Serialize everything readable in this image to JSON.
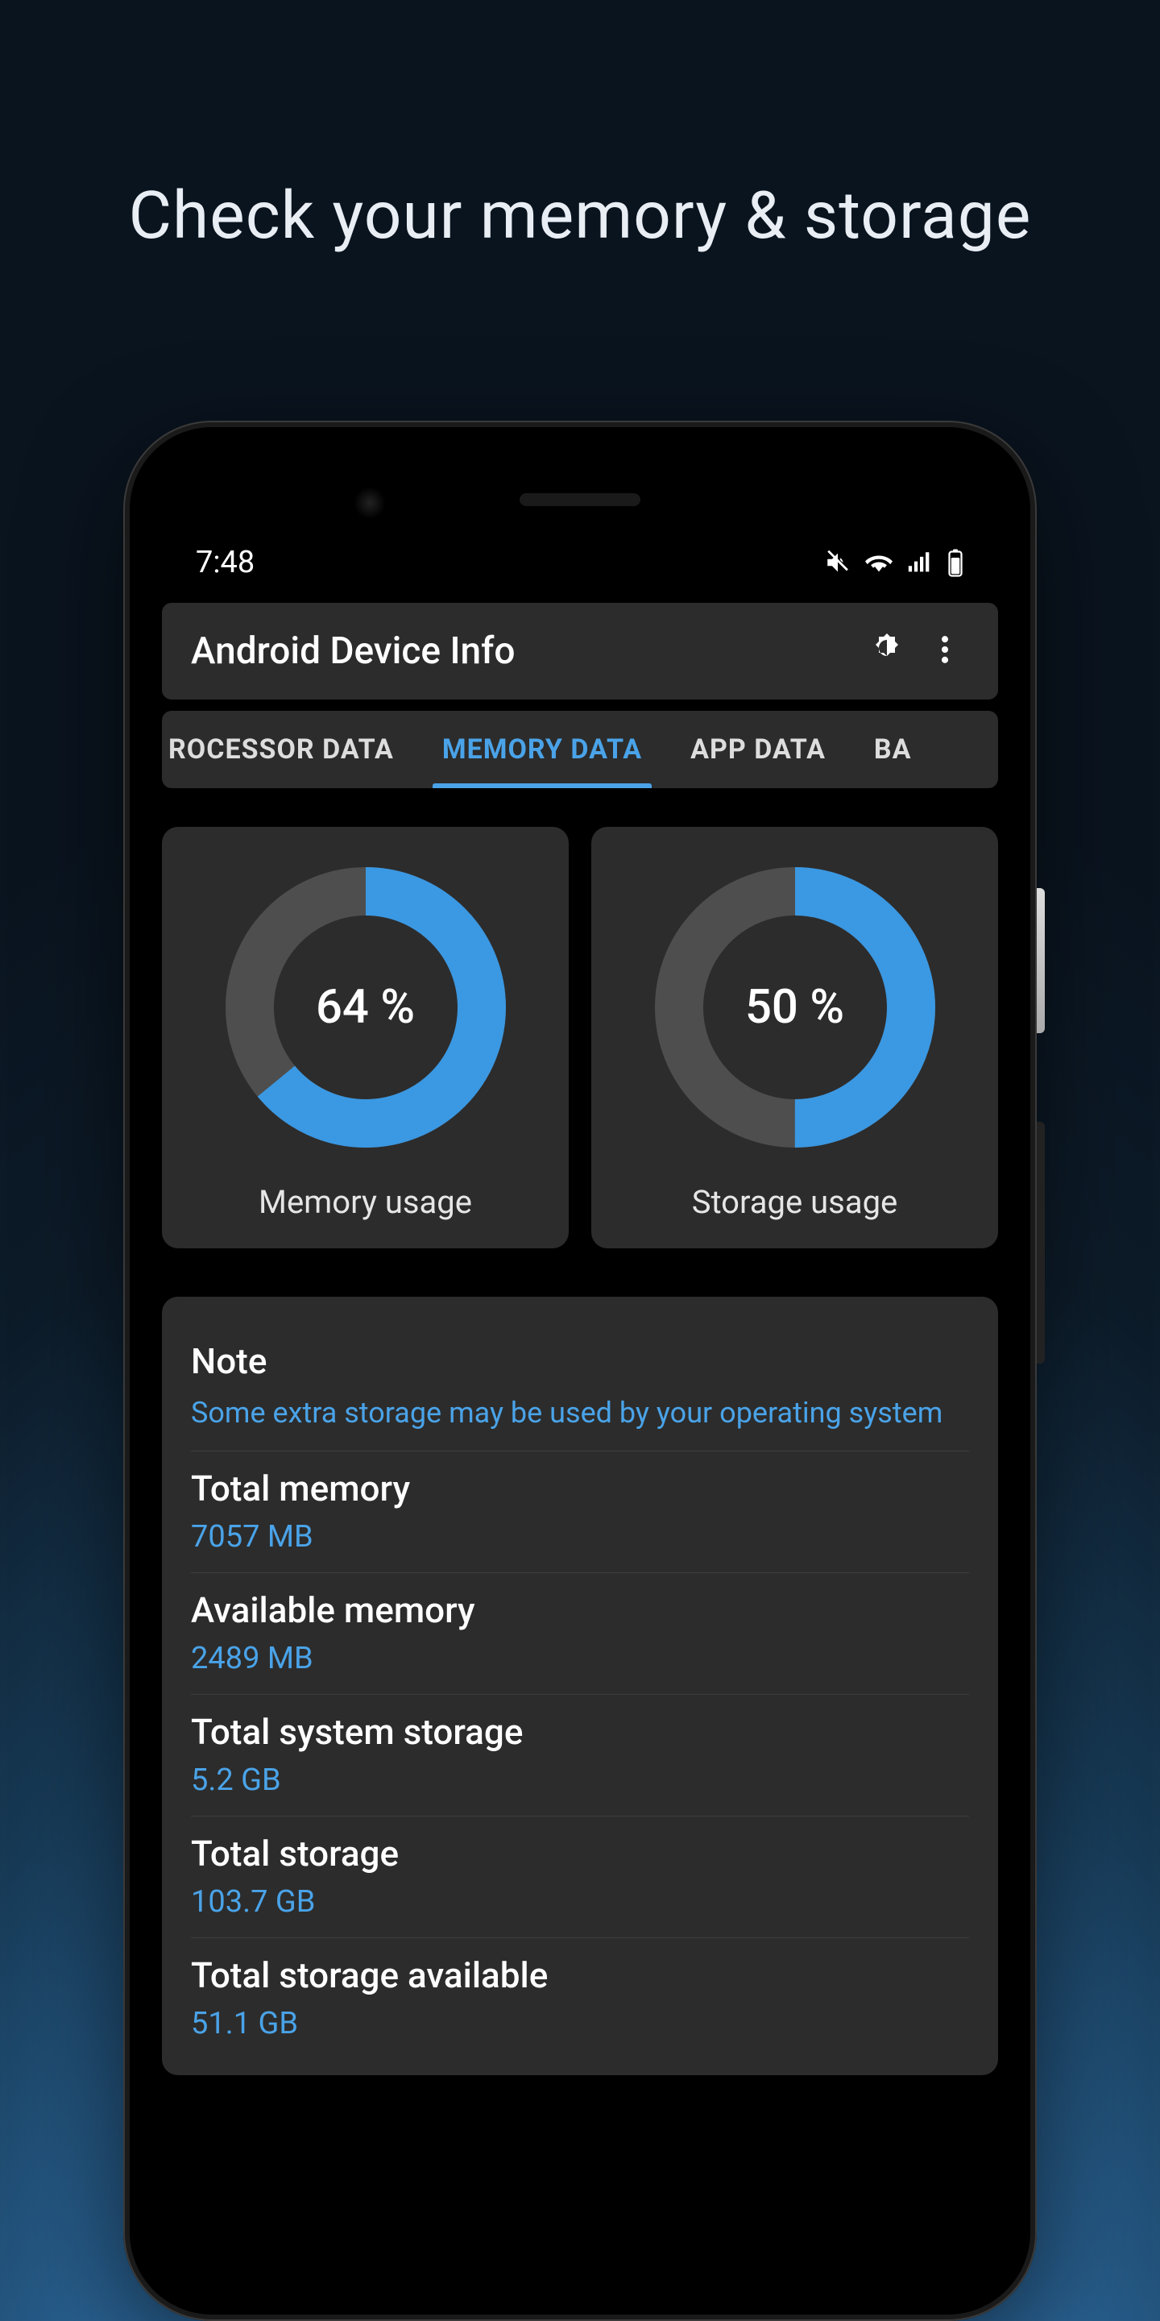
{
  "promo": {
    "title": "Check your memory & storage"
  },
  "status": {
    "time": "7:48"
  },
  "appbar": {
    "title": "Android Device Info"
  },
  "tabs": {
    "items": [
      {
        "label": "ROCESSOR DATA",
        "active": false,
        "cut": "left"
      },
      {
        "label": "MEMORY DATA",
        "active": true
      },
      {
        "label": "APP DATA",
        "active": false
      },
      {
        "label": "BA",
        "active": false,
        "cut": "right"
      }
    ]
  },
  "gauges": {
    "memory": {
      "percent": 64,
      "percent_label": "64 %",
      "label": "Memory usage"
    },
    "storage": {
      "percent": 50,
      "percent_label": "50 %",
      "label": "Storage usage"
    }
  },
  "info": {
    "note": {
      "title": "Note",
      "text": "Some extra storage may be used by your operating system"
    },
    "rows": [
      {
        "label": "Total memory",
        "value": "7057 MB"
      },
      {
        "label": "Available memory",
        "value": "2489 MB"
      },
      {
        "label": "Total system storage",
        "value": "5.2 GB"
      },
      {
        "label": "Total storage",
        "value": "103.7 GB"
      },
      {
        "label": "Total storage available",
        "value": "51.1 GB"
      }
    ]
  },
  "colors": {
    "accent": "#4aa3e8"
  }
}
